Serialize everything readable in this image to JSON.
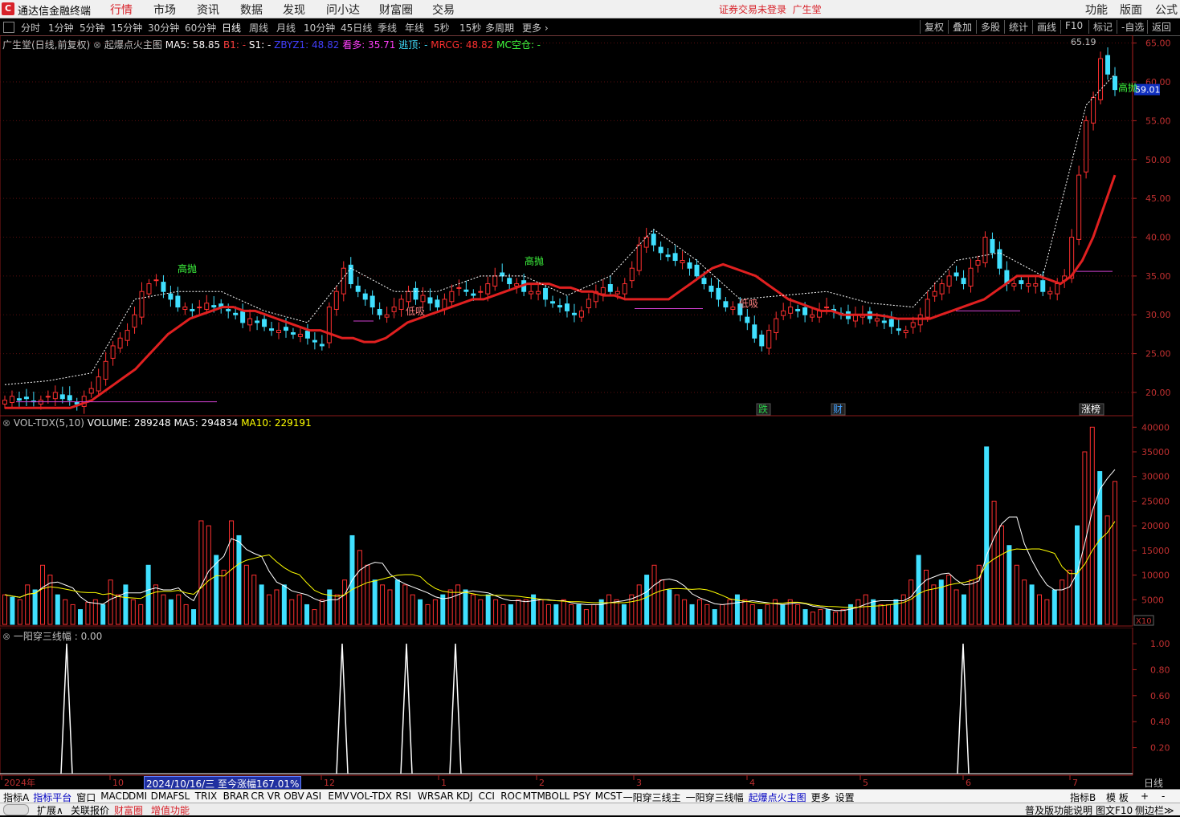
{
  "app": {
    "title": "通达信金融终端",
    "login_status": "证券交易未登录",
    "stock_name": "广生堂"
  },
  "menu": {
    "items": [
      "行情",
      "市场",
      "资讯",
      "数据",
      "发现",
      "问小达",
      "财富圈",
      "交易"
    ],
    "active": "行情",
    "right_items": [
      "功能",
      "版面",
      "公式"
    ]
  },
  "toolbar": {
    "periods": [
      "分时",
      "1分钟",
      "5分钟",
      "15分钟",
      "30分钟",
      "60分钟",
      "日线",
      "周线",
      "月线",
      "10分钟",
      "45日线",
      "季线",
      "年线",
      "5秒",
      "15秒",
      "多周期",
      "更多"
    ],
    "active_period": "日线",
    "buttons": [
      "复权",
      "叠加",
      "多股",
      "统计",
      "画线",
      "F10",
      "-自选",
      "返回"
    ]
  },
  "main_panel": {
    "stock_label": "广生堂(日线,前复权)",
    "indicator_name": "起爆点火主图",
    "ma5": "MA5: 58.85",
    "b1": "B1: -",
    "s1": "S1: -",
    "zbyz": "ZBYZ1: 48.82",
    "kanduo": "看多: 35.71",
    "taoding": "逃顶: -",
    "mrcg": "MRCG: 48.82",
    "mckc": "MC空仓: -",
    "high_price": "65.19",
    "current_price": "59.01",
    "signal_high": "高抛",
    "signal_low": "低吸",
    "price_axis": [
      "65.00",
      "60.00",
      "55.00",
      "50.00",
      "45.00",
      "40.00",
      "35.00",
      "30.00",
      "25.00",
      "20.00"
    ],
    "events": [
      {
        "label": "跌",
        "color": "#2ad04a"
      },
      {
        "label": "财",
        "color": "#40a0ff"
      },
      {
        "label": "涨榜",
        "color": "#ffffff"
      }
    ]
  },
  "volume_panel": {
    "name": "VOL-TDX(5,10)",
    "volume": "VOLUME: 289248",
    "ma5": "MA5: 294834",
    "ma10": "MA10: 229191",
    "axis": [
      "40000",
      "35000",
      "30000",
      "25000",
      "20000",
      "15000",
      "10000",
      "5000"
    ],
    "unit": "X10"
  },
  "indicator_panel": {
    "name": "一阳穿三线幅 : 0.00",
    "axis": [
      "1.00",
      "0.80",
      "0.60",
      "0.40",
      "0.20"
    ]
  },
  "time_axis": {
    "labels": [
      "2024年",
      "10",
      "12",
      "1",
      "2",
      "3",
      "4",
      "5",
      "6",
      "7"
    ],
    "highlight": "2024/10/16/三  至今涨幅167.01%",
    "period": "日线"
  },
  "indicator_tabs": [
    "指标A",
    "指标平台",
    "窗口",
    "MACD",
    "DMI",
    "DMA",
    "FSL",
    "TRIX",
    "BRAR",
    "CR",
    "VR",
    "OBV",
    "ASI",
    "EMV",
    "VOL-TDX",
    "RSI",
    "WR",
    "SAR",
    "KDJ",
    "CCI",
    "ROC",
    "MTM",
    "BOLL",
    "PSY",
    "MCST",
    "一阳穿三线主",
    "一阳穿三线幅",
    "起爆点火主图",
    "更多",
    "设置"
  ],
  "right_tabs": [
    "指标B",
    "模 板",
    "+",
    "-"
  ],
  "statusbar": {
    "left": [
      "扩展∧",
      "关联报价",
      "财富圈",
      "增值功能"
    ],
    "right": [
      "普及版功能说明",
      "图文F10",
      "侧边栏≫"
    ]
  },
  "chart_data": [
    {
      "type": "candlestick",
      "title": "广生堂(日线,前复权)",
      "ylim": [
        17,
        66
      ],
      "grid": true,
      "series": [
        {
          "name": "收盘价(近似)",
          "values": [
            19,
            19.5,
            19,
            19.2,
            18.8,
            19,
            19.5,
            20,
            19.2,
            19,
            18.5,
            19.5,
            20.5,
            22,
            24,
            26,
            27,
            28,
            30,
            33,
            34,
            34.5,
            33,
            32,
            31,
            31,
            30.5,
            31,
            31.5,
            31,
            31,
            30.5,
            30,
            29,
            29.5,
            29,
            28.5,
            28,
            28,
            28,
            27.5,
            27.5,
            27,
            26.5,
            26,
            31,
            33,
            36,
            34,
            33,
            32,
            31,
            30,
            30,
            31,
            32,
            33,
            32,
            32.5,
            31.5,
            31,
            32,
            33,
            33.5,
            33,
            32.5,
            33,
            34,
            35,
            35,
            34,
            34,
            33,
            33,
            33,
            32,
            31.5,
            31,
            30.5,
            30,
            30.5,
            32,
            33,
            33.5,
            33,
            33,
            34,
            36,
            39,
            40,
            39,
            38,
            37.5,
            37,
            37,
            36,
            35,
            34,
            33,
            32,
            31,
            31,
            30,
            29,
            27,
            26,
            28,
            29.5,
            30.5,
            31,
            30.5,
            30,
            30,
            30.5,
            31,
            30.5,
            30,
            29.5,
            30,
            30,
            29.5,
            29.5,
            29,
            28.5,
            28,
            28,
            29,
            30,
            32,
            33,
            34,
            35,
            35,
            34,
            36,
            37,
            40,
            38,
            36,
            34,
            34,
            34,
            34,
            34,
            33,
            33,
            34,
            35,
            40,
            48,
            55,
            58,
            63,
            61,
            59.01
          ]
        },
        {
          "name": "起爆线",
          "values": [
            18,
            18,
            18,
            18,
            18,
            18,
            18,
            18.5,
            19,
            20,
            21,
            22,
            23,
            24.5,
            26,
            27.5,
            28.5,
            29.5,
            30,
            30.5,
            31,
            31,
            30.5,
            30.5,
            30,
            29.5,
            29,
            28.5,
            28,
            28,
            27.5,
            27,
            27,
            26.5,
            26.5,
            27,
            28,
            29,
            29.5,
            30,
            30.5,
            31,
            31.5,
            32,
            32,
            32.5,
            33,
            33.5,
            34,
            34,
            34,
            33.5,
            33.5,
            33,
            33,
            32.5,
            32.5,
            32,
            32,
            32,
            32,
            32,
            33,
            34,
            35,
            36,
            36.5,
            36,
            35.5,
            35,
            34,
            33,
            32,
            31.5,
            31,
            30.5,
            30.5,
            30,
            30,
            30,
            30,
            29.8,
            29.5,
            29.5,
            29.5,
            29.5,
            30,
            30.5,
            31,
            31.5,
            32,
            33,
            34,
            35,
            35,
            35,
            34.5,
            34,
            35,
            37,
            40,
            44,
            48
          ]
        }
      ]
    },
    {
      "type": "bar",
      "title": "VOL-TDX(5,10)",
      "ylim": [
        0,
        42000
      ],
      "series": [
        {
          "name": "VOLUME",
          "values": [
            6000,
            5500,
            5000,
            8000,
            7000,
            12000,
            10000,
            6000,
            5000,
            4000,
            3000,
            4500,
            5000,
            4000,
            9000,
            6000,
            8000,
            5000,
            4000,
            12000,
            8000,
            6000,
            5000,
            6000,
            4000,
            3000,
            21000,
            20000,
            14000,
            11000,
            21000,
            18000,
            12000,
            10000,
            8000,
            6000,
            7000,
            8000,
            5000,
            6000,
            4000,
            3000,
            5000,
            7000,
            6000,
            9000,
            18000,
            15000,
            12000,
            9000,
            8000,
            7000,
            9000,
            8000,
            6000,
            5000,
            4000,
            5000,
            6000,
            7000,
            8000,
            7000,
            6000,
            5000,
            6000,
            5000,
            4000,
            4000,
            5000,
            5000,
            6000,
            5000,
            4000,
            4000,
            5000,
            4000,
            4000,
            3000,
            4000,
            5000,
            6000,
            5000,
            4000,
            6000,
            8000,
            10000,
            12000,
            9000,
            7000,
            6000,
            5000,
            4000,
            5000,
            4000,
            3000,
            4000,
            5000,
            6000,
            5000,
            4000,
            3000,
            4000,
            5000,
            4000,
            5000,
            4000,
            3000,
            2500,
            3000,
            3000,
            2500,
            3000,
            4000,
            5000,
            6000,
            5000,
            4000,
            4000,
            5000,
            6000,
            9000,
            14000,
            11000,
            8000,
            9000,
            10000,
            7000,
            6000,
            9000,
            12000,
            36000,
            25000,
            20000,
            16000,
            12000,
            9000,
            8000,
            6000,
            5000,
            7000,
            9000,
            11000,
            20000,
            35000,
            40000,
            31000,
            22000,
            29000
          ]
        }
      ]
    },
    {
      "type": "line",
      "title": "一阳穿三线幅",
      "ylim": [
        0,
        1
      ],
      "series": [
        {
          "name": "一阳穿三线幅",
          "peaks_at_label_positions": [
            "2024年末",
            "12月初",
            "12月中",
            "1月初",
            "6月初"
          ],
          "values": [
            1,
            1,
            1,
            1,
            1
          ]
        }
      ]
    }
  ]
}
